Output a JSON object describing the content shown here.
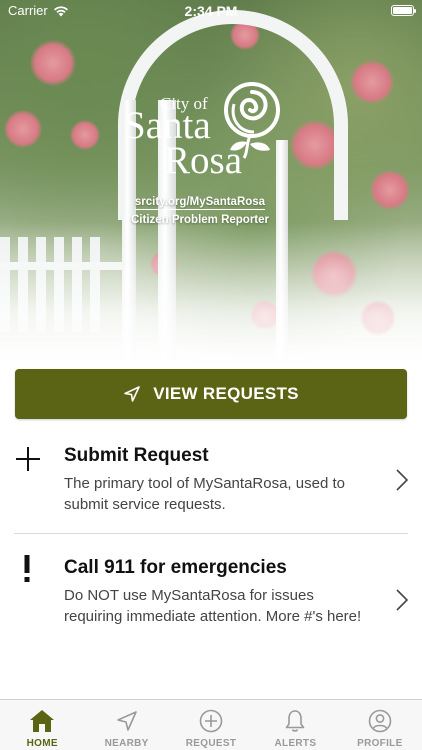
{
  "status_bar": {
    "carrier": "Carrier",
    "time": "2:34 PM"
  },
  "logo": {
    "city_of": "City of",
    "santa": "Santa",
    "rosa": "Rosa"
  },
  "hero": {
    "url": "srcity.org/MySantaRosa",
    "subtitle": "Citizen Problem Reporter"
  },
  "primary_button": {
    "label": "VIEW REQUESTS",
    "icon": "send-icon"
  },
  "rows": [
    {
      "title": "Submit Request",
      "description": "The primary tool of MySantaRosa, used to submit service requests.",
      "icon": "plus-icon"
    },
    {
      "title": "Call 911 for emergencies",
      "description": "Do NOT use MySantaRosa for issues requiring immediate attention. More #'s here!",
      "icon": "exclamation-icon"
    }
  ],
  "tabs": [
    {
      "label": "HOME",
      "icon": "home-icon",
      "active": true
    },
    {
      "label": "NEARBY",
      "icon": "location-arrow-icon",
      "active": false
    },
    {
      "label": "REQUEST",
      "icon": "plus-circle-icon",
      "active": false
    },
    {
      "label": "ALERTS",
      "icon": "bell-icon",
      "active": false
    },
    {
      "label": "PROFILE",
      "icon": "user-circle-icon",
      "active": false
    }
  ],
  "colors": {
    "accent": "#5b6414",
    "tab_inactive": "#9a9a9a",
    "text": "#111111"
  }
}
